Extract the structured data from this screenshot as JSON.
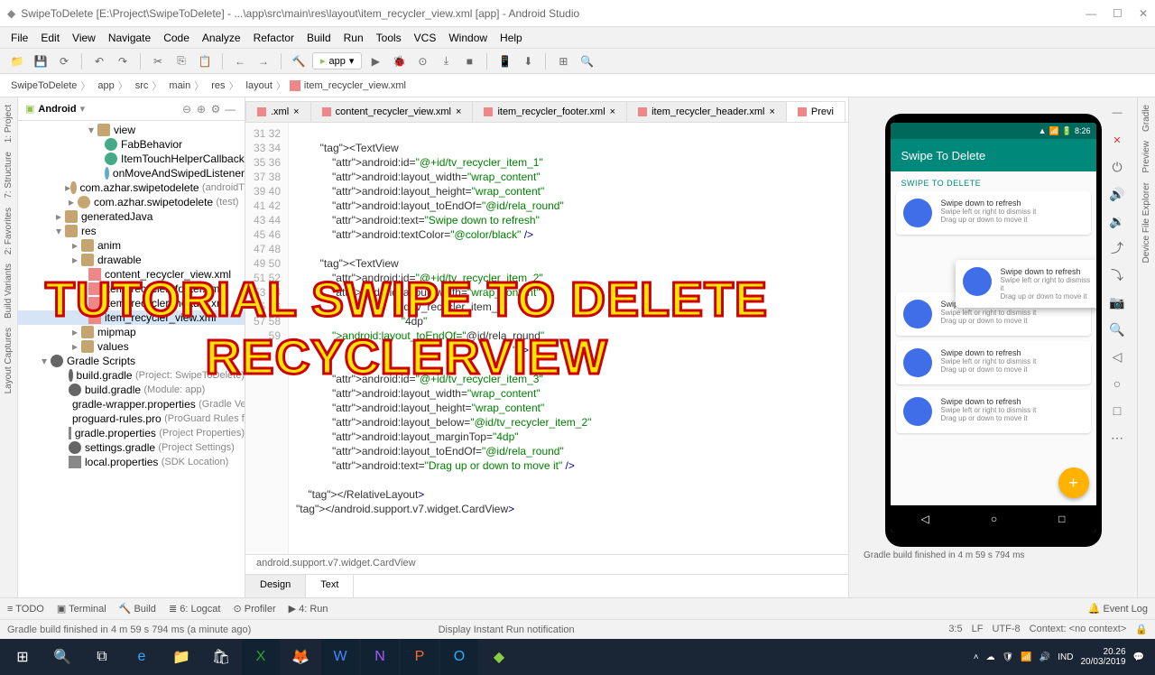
{
  "title": "SwipeToDelete [E:\\Project\\SwipeToDelete] - ...\\app\\src\\main\\res\\layout\\item_recycler_view.xml [app] - Android Studio",
  "menu": [
    "File",
    "Edit",
    "View",
    "Navigate",
    "Code",
    "Analyze",
    "Refactor",
    "Build",
    "Run",
    "Tools",
    "VCS",
    "Window",
    "Help"
  ],
  "toolbar": {
    "config": "app"
  },
  "breadcrumb": [
    "SwipeToDelete",
    "app",
    "src",
    "main",
    "res",
    "layout",
    "item_recycler_view.xml"
  ],
  "project": {
    "label": "Android",
    "tree": {
      "view": "view",
      "fabBehavior": "FabBehavior",
      "itemTouch": "ItemTouchHelperCallback",
      "onMove": "onMoveAndSwipedListener",
      "pkg1": "com.azhar.swipetodelete",
      "pkg1m": "(androidT",
      "pkg2": "com.azhar.swipetodelete",
      "pkg2m": "(test)",
      "genJava": "generatedJava",
      "res": "res",
      "anim": "anim",
      "drawable": "drawable",
      "contentRv": "content_recycler_view.xml",
      "footer": "item_recycler_footer.xml",
      "header": "item_recycler_header.xml",
      "itemRv": "item_recycler_view.xml",
      "mipmap": "mipmap",
      "values": "values",
      "gradleScripts": "Gradle Scripts",
      "bgProj": "build.gradle",
      "bgProjM": "(Project: SwipeToDelete)",
      "bgMod": "build.gradle",
      "bgModM": "(Module: app)",
      "gwp": "gradle-wrapper.properties",
      "gwpM": "(Gradle Ve",
      "pro": "proguard-rules.pro",
      "proM": "(ProGuard Rules fo",
      "gp": "gradle.properties",
      "gpM": "(Project Properties)",
      "set": "settings.gradle",
      "setM": "(Project Settings)",
      "lp": "local.properties",
      "lpM": "(SDK Location)"
    }
  },
  "tabs": [
    {
      "label": ".xml",
      "active": false
    },
    {
      "label": "content_recycler_view.xml",
      "active": false
    },
    {
      "label": "item_recycler_footer.xml",
      "active": false
    },
    {
      "label": "item_recycler_header.xml",
      "active": false
    },
    {
      "label": "Previ",
      "active": true
    }
  ],
  "lineStart": 31,
  "lineEnd": 59,
  "code": "\n        <TextView\n            android:id=\"@+id/tv_recycler_item_1\"\n            android:layout_width=\"wrap_content\"\n            android:layout_height=\"wrap_content\"\n            android:layout_toEndOf=\"@id/rela_round\"\n            android:text=\"Swipe down to refresh\"\n            android:textColor=\"@color/black\" />\n\n        <TextView\n            android:id=\"@+id/tv_recycler_item_2\"\n            android:layout_width=\"wrap_content\"\n                                   id/tv_recycler_item_1\"\n                                   \"4dp\"\n            android:layout_toEndOf=\"@id/rela_round\"\n                                                                        \" />\n\n            android:id=\"@+id/tv_recycler_item_3\"\n            android:layout_width=\"wrap_content\"\n            android:layout_height=\"wrap_content\"\n            android:layout_below=\"@id/tv_recycler_item_2\"\n            android:layout_marginTop=\"4dp\"\n            android:layout_toEndOf=\"@id/rela_round\"\n            android:text=\"Drag up or down to move it\" />\n\n    </RelativeLayout>\n</android.support.v7.widget.CardView>",
  "breadcrumb2": "android.support.v7.widget.CardView",
  "designTabs": {
    "design": "Design",
    "text": "Text"
  },
  "preview": {
    "appTitle": "Swipe To Delete",
    "subheader": "SWIPE TO DELETE",
    "cardTitle": "Swipe down to refresh",
    "cardLine2": "Swipe left or right to dismiss it",
    "cardLine3": "Drag up or down to move it"
  },
  "bottomTools": [
    "TODO",
    "Terminal",
    "Build",
    "6: Logcat",
    "Profiler",
    "4: Run"
  ],
  "eventLog": "Event Log",
  "status": {
    "msg": "Gradle build finished in 4 m 59 s 794 ms (a minute ago)",
    "center": "Display Instant Run notification",
    "pos": "3:5",
    "le": "LF",
    "enc": "UTF-8",
    "ctx": "Context: <no context>"
  },
  "buildResult": "Gradle build finished in 4 m 59 s 794 ms",
  "taskbar": {
    "time": "20.26",
    "date": "20/03/2019",
    "lang": "IND"
  },
  "overlay": {
    "l1": "TUTORIAL SWIPE TO DELETE",
    "l2": "RECYCLERVIEW"
  }
}
